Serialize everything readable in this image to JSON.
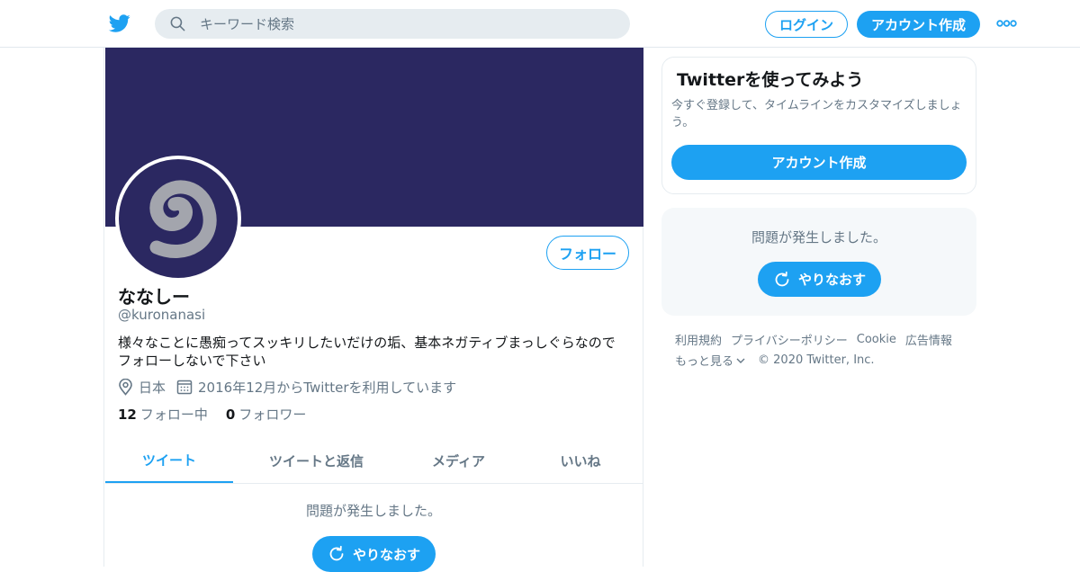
{
  "header": {
    "search_placeholder": "キーワード検索",
    "login_label": "ログイン",
    "signup_label": "アカウント作成"
  },
  "profile": {
    "display_name": "ななしー",
    "handle": "@kuronanasi",
    "bio_line1": "様々なことに愚痴ってスッキリしたいだけの垢、基本ネガティブまっしぐらなので",
    "bio_line2": "フォローしないで下さい",
    "location": "日本",
    "joined": "2016年12月からTwitterを利用しています",
    "follow_label": "フォロー",
    "following_count": "12",
    "following_label": "フォロー中",
    "followers_count": "0",
    "followers_label": "フォロワー",
    "banner_color": "#2b2861"
  },
  "tabs": [
    {
      "label": "ツイート",
      "active": true
    },
    {
      "label": "ツイートと返信",
      "active": false
    },
    {
      "label": "メディア",
      "active": false
    },
    {
      "label": "いいね",
      "active": false
    }
  ],
  "timeline_error": {
    "message": "問題が発生しました。",
    "retry_label": "やりなおす"
  },
  "signup_card": {
    "title": "Twitterを使ってみよう",
    "description": "今すぐ登録して、タイムラインをカスタマイズしましょう。",
    "button_label": "アカウント作成"
  },
  "sidebar_error": {
    "message": "問題が発生しました。",
    "retry_label": "やりなおす"
  },
  "footer": {
    "links": [
      "利用規約",
      "プライバシーポリシー",
      "Cookie",
      "広告情報"
    ],
    "more_label": "もっと見る",
    "copyright": "© 2020 Twitter, Inc."
  },
  "colors": {
    "accent": "#1da1f2",
    "secondary_text": "#657786"
  },
  "icons": {
    "logo": "twitter-bird-icon",
    "search": "search-icon",
    "more": "more-dots-icon",
    "location": "location-pin-icon",
    "calendar": "calendar-icon",
    "retry": "refresh-icon",
    "chevron": "chevron-down-icon"
  }
}
